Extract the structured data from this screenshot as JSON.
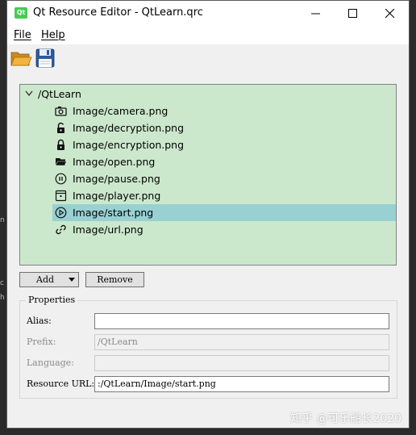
{
  "window": {
    "title": "Qt Resource Editor - QtLearn.qrc",
    "app_icon_text": "Qt"
  },
  "menu": {
    "file": "File",
    "help": "Help"
  },
  "toolbar": {
    "open_icon": "folder-open-icon",
    "save_icon": "floppy-save-icon"
  },
  "tree": {
    "root": "/QtLearn",
    "items": [
      {
        "label": "Image/camera.png",
        "icon": "camera-icon"
      },
      {
        "label": "Image/decryption.png",
        "icon": "unlock-icon"
      },
      {
        "label": "Image/encryption.png",
        "icon": "lock-icon"
      },
      {
        "label": "Image/open.png",
        "icon": "folder-icon"
      },
      {
        "label": "Image/pause.png",
        "icon": "pause-icon"
      },
      {
        "label": "Image/player.png",
        "icon": "player-icon"
      },
      {
        "label": "Image/start.png",
        "icon": "play-icon",
        "selected": true
      },
      {
        "label": "Image/url.png",
        "icon": "link-icon"
      }
    ]
  },
  "buttons": {
    "add": "Add",
    "remove": "Remove"
  },
  "properties": {
    "title": "Properties",
    "alias_label": "Alias:",
    "alias_value": "",
    "prefix_label": "Prefix:",
    "prefix_value": "/QtLearn",
    "language_label": "Language:",
    "language_value": "",
    "url_label": "Resource URL:",
    "url_value": ":/QtLearn/Image/start.png"
  },
  "watermark": "知乎 @可乐船长2020",
  "colors": {
    "tree_bg": "#cce8cc",
    "selection": "#99d1d3",
    "window_bg": "#f0f0f0"
  }
}
